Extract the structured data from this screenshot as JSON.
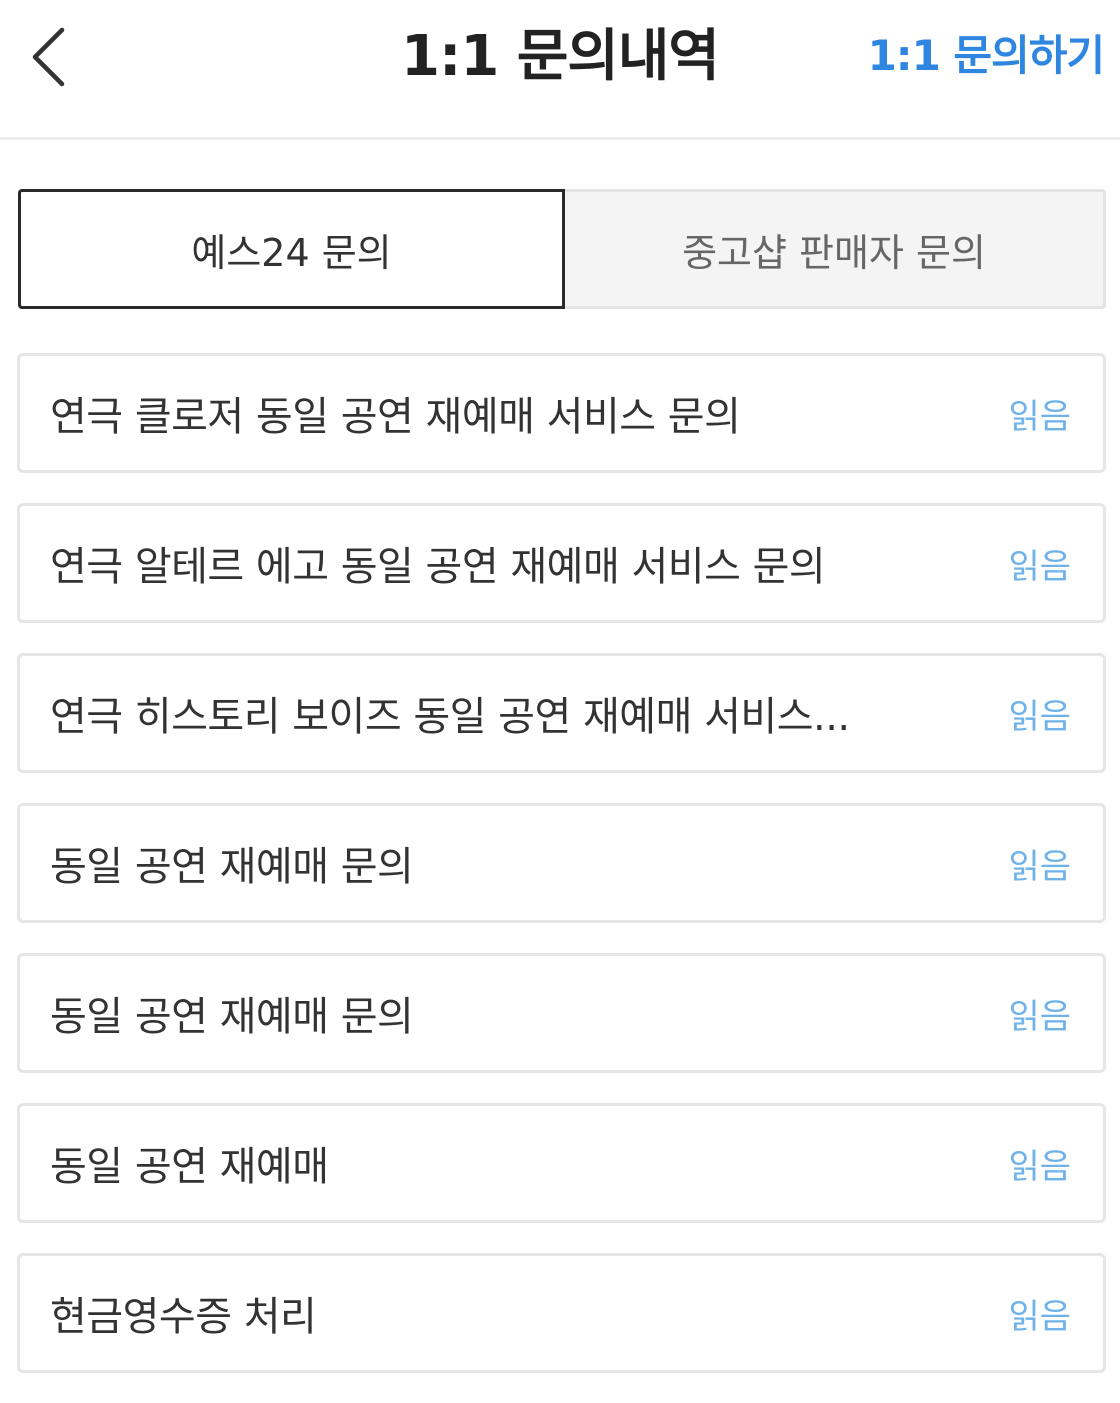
{
  "header": {
    "back_icon": "chevron-left-icon",
    "title": "1:1 문의내역",
    "action_label": "1:1 문의하기",
    "action_color": "#2f86e0"
  },
  "tabs": [
    {
      "label": "예스24 문의",
      "active": true
    },
    {
      "label": "중고샵 판매자 문의",
      "active": false
    }
  ],
  "inquiries": [
    {
      "title": "연극 클로저 동일 공연 재예매 서비스 문의",
      "status": "읽음"
    },
    {
      "title": "연극 알테르 에고 동일 공연 재예매 서비스 문의",
      "status": "읽음"
    },
    {
      "title": "연극 히스토리 보이즈 동일 공연 재예매 서비스...",
      "status": "읽음"
    },
    {
      "title": "동일 공연 재예매 문의",
      "status": "읽음"
    },
    {
      "title": "동일 공연 재예매 문의",
      "status": "읽음"
    },
    {
      "title": "동일 공연 재예매",
      "status": "읽음"
    },
    {
      "title": "현금영수증 처리",
      "status": "읽음"
    }
  ],
  "colors": {
    "status_read": "#6fb2ea",
    "active_tab_border": "#2a2a2a",
    "inactive_tab_bg": "#f4f4f4"
  }
}
